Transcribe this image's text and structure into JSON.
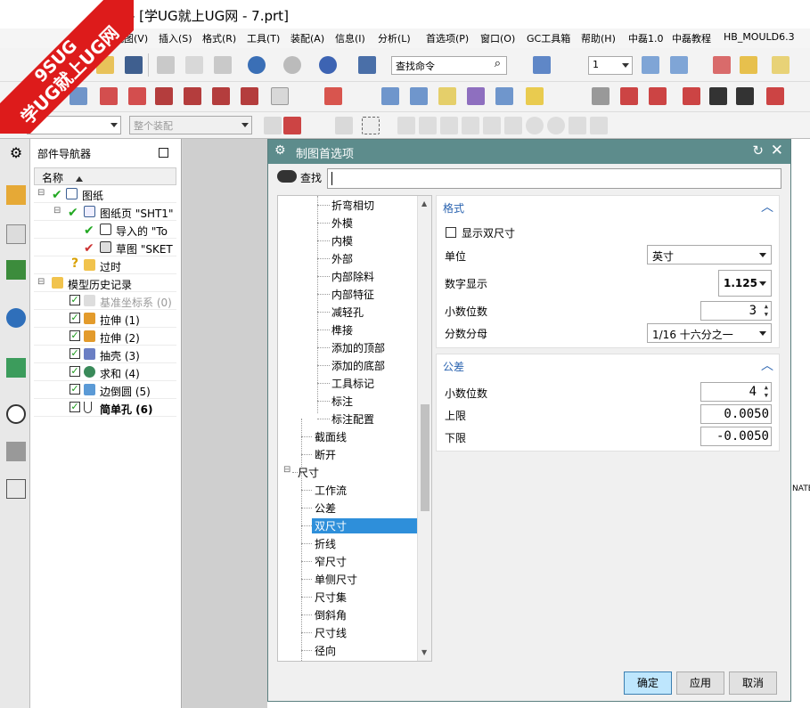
{
  "window": {
    "title": "- [学UG就上UG网 - 7.prt]"
  },
  "watermark": {
    "line1": "9SUG",
    "line2": "学UG就上UG网"
  },
  "menu": [
    "视图(V)",
    "插入(S)",
    "格式(R)",
    "工具(T)",
    "装配(A)",
    "信息(I)",
    "分析(L)",
    "首选项(P)",
    "窗口(O)",
    "GC工具箱",
    "帮助(H)",
    "中磊1.0",
    "中磊教程",
    "HB_MOULD6.3"
  ],
  "toolbar": {
    "search_command": "查找命令",
    "layer_value": "1",
    "filter_placeholder": "",
    "assembly_scope": "整个装配"
  },
  "navigator": {
    "title": "部件导航器",
    "column": "名称",
    "nodes": {
      "drawing": "图纸",
      "sheet": "图纸页 \"SHT1\"",
      "imported": "导入的 \"To",
      "sketch": "草图 \"SKET",
      "outdated": "过时",
      "history": "模型历史记录",
      "datum": "基准坐标系 (0)",
      "extrude1": "拉伸 (1)",
      "extrude2": "拉伸 (2)",
      "shell": "抽壳 (3)",
      "unite": "求和 (4)",
      "blend": "边倒圆 (5)",
      "hole": "简单孔 (6)"
    }
  },
  "dialog": {
    "title": "制图首选项",
    "find_label": "查找",
    "find_value": "",
    "tree": {
      "items": [
        "折弯相切",
        "外模",
        "内模",
        "外部",
        "内部除料",
        "内部特征",
        "减轻孔",
        "榫接",
        "添加的顶部",
        "添加的底部",
        "工具标记",
        "标注",
        "标注配置"
      ],
      "section_cut": "截面线",
      "break": "断开",
      "dimension": "尺寸",
      "dim_items": [
        "工作流",
        "公差",
        "双尺寸",
        "折线",
        "窄尺寸",
        "单侧尺寸",
        "尺寸集",
        "倒斜角",
        "尺寸线",
        "径向"
      ]
    },
    "format": {
      "header": "格式",
      "show_dual_label": "显示双尺寸",
      "show_dual_checked": false,
      "unit_label": "单位",
      "unit_value": "英寸",
      "numeric_label": "数字显示",
      "numeric_value": "1.125",
      "decimals_label": "小数位数",
      "decimals_value": "3",
      "fraction_label": "分数分母",
      "fraction_value": "1/16 十六分之一"
    },
    "tolerance": {
      "header": "公差",
      "decimals_label": "小数位数",
      "decimals_value": "4",
      "upper_label": "上限",
      "upper_value": "0.0050",
      "lower_label": "下限",
      "lower_value": "-0.0050"
    },
    "buttons": {
      "ok": "确定",
      "apply": "应用",
      "cancel": "取消"
    }
  },
  "graphics": {
    "edge_text": "NATE"
  }
}
